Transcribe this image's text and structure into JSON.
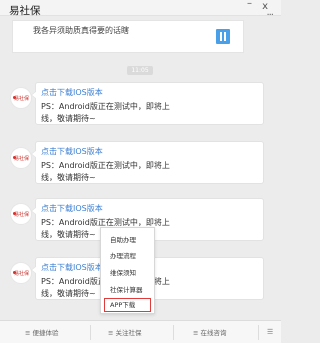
{
  "window": {
    "title": "易社保",
    "minimize": "–",
    "close": "x",
    "menu": "···"
  },
  "article": {
    "text": "我各异须助质真得要的话瞎"
  },
  "timestamp": "11:05",
  "messages": [
    {
      "avatar": "易社保",
      "link": "点击下载IOS版本",
      "line1": "PS：Android版正在测试中，即将上",
      "line2": "线，敬请期待~"
    },
    {
      "avatar": "易社保",
      "link": "点击下载IOS版本",
      "line1": "PS：Android版正在测试中，即将上",
      "line2": "线，敬请期待~"
    },
    {
      "avatar": "易社保",
      "link": "点击下载IOS版本",
      "line1": "PS：Android版正在测试中，即将上",
      "line2": "线，敬请期待~"
    },
    {
      "avatar": "易社保",
      "link": "点击下载IOS版本",
      "line1": "PS：Android版正在测试中，即将上",
      "line2": "线，敬请期待~"
    }
  ],
  "popup_menu": {
    "items": [
      "自助办理",
      "办理流程",
      "维保须知",
      "社保计算器",
      "APP下载"
    ],
    "highlighted_item": "APP下载",
    "highlight_color": "#e03a3a"
  },
  "bottom_bar": {
    "tabs": [
      "≡ 便捷体验",
      "≡ 关注社保",
      "≡ 在线咨询"
    ],
    "keyboard_icon": "keyboard-toggle-icon"
  },
  "colors": {
    "link": "#3b7fd3",
    "background": "#ececec"
  }
}
